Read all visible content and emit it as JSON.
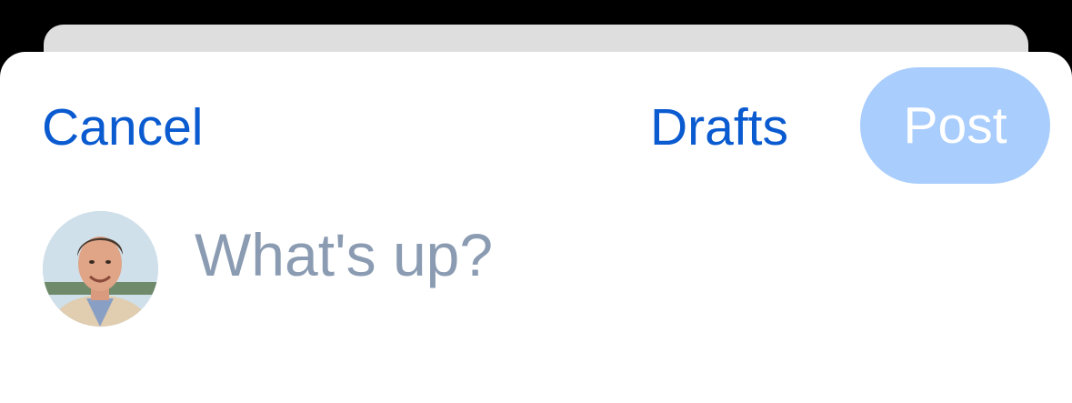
{
  "header": {
    "cancel_label": "Cancel",
    "drafts_label": "Drafts",
    "post_label": "Post"
  },
  "composer": {
    "placeholder": "What's up?",
    "value": ""
  },
  "colors": {
    "accent": "#0a5ad0",
    "post_disabled_bg": "#a9cdfd",
    "placeholder": "#8a9bb2"
  }
}
